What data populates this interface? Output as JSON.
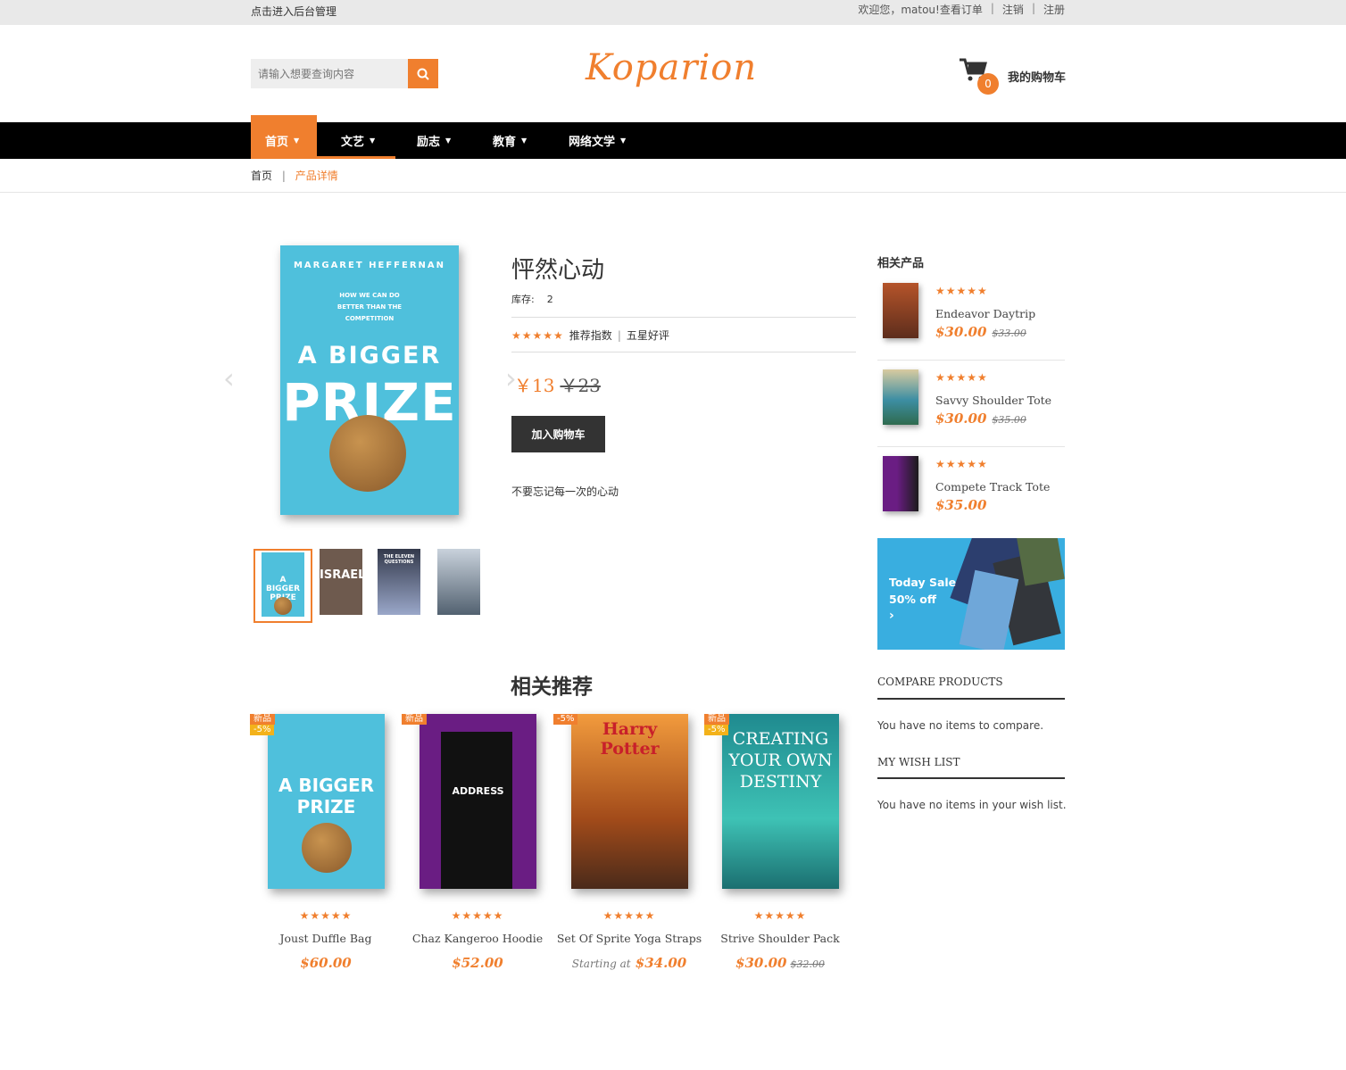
{
  "topbar": {
    "admin": "点击进入后台管理",
    "welcome": "欢迎您，matou!",
    "orders": "查看订单",
    "logout": "注销",
    "register": "注册"
  },
  "search": {
    "placeholder": "请输入想要查询内容"
  },
  "logo": "Koparion",
  "cart": {
    "count": "0",
    "label": "我的购物车"
  },
  "nav": [
    "首页",
    "文艺",
    "励志",
    "教育",
    "网络文学"
  ],
  "breadcrumb": {
    "home": "首页",
    "current": "产品详情"
  },
  "product": {
    "title": "怦然心动",
    "stock_label": "库存:",
    "stock": "2",
    "rating_text1": "推荐指数",
    "rating_text2": "五星好评",
    "price": "￥13",
    "old_price": "￥23",
    "add_to_cart": "加入购物车",
    "description": "不要忘记每一次的心动"
  },
  "main_cover": {
    "author": "MARGARET HEFFERNAN",
    "subtitle": "HOW WE CAN DO BETTER THAN THE COMPETITION",
    "title1": "A BIGGER",
    "title2": "PRIZE"
  },
  "thumb_covers": [
    "A BIGGER PRIZE",
    "ISRAEL",
    "THE ELEVEN QUESTIONS",
    ""
  ],
  "related": {
    "title": "相关产品",
    "items": [
      {
        "name": "Endeavor Daytrip",
        "price": "$30.00",
        "old": "$33.00"
      },
      {
        "name": "Savvy Shoulder Tote",
        "price": "$30.00",
        "old": "$35.00"
      },
      {
        "name": "Compete Track Tote",
        "price": "$35.00",
        "old": ""
      }
    ]
  },
  "banner": {
    "line1": "Today Sale",
    "line2": "50% off",
    "arrow": "›"
  },
  "compare": {
    "title": "COMPARE PRODUCTS",
    "text": "You have no items to compare."
  },
  "wishlist": {
    "title": "MY WISH LIST",
    "text": "You have no items in your wish list."
  },
  "recommend": {
    "title": "相关推荐",
    "items": [
      {
        "name": "Joust Duffle Bag",
        "price": "$60.00",
        "old": "",
        "prefix": "",
        "tag": "新品",
        "tag2": "-5%",
        "cover": "A BIGGER PRIZE"
      },
      {
        "name": "Chaz Kangeroo Hoodie",
        "price": "$52.00",
        "old": "",
        "prefix": "",
        "tag": "新品",
        "tag2": "",
        "cover": "ADDRESS"
      },
      {
        "name": "Set Of Sprite Yoga Straps",
        "price": "$34.00",
        "old": "",
        "prefix": "Starting at",
        "tag": "-5%",
        "tag2": "",
        "cover": "Harry Potter"
      },
      {
        "name": "Strive Shoulder Pack",
        "price": "$30.00",
        "old": "$32.00",
        "prefix": "",
        "tag": "新品",
        "tag2": "-5%",
        "cover": "CREATING YOUR OWN DESTINY"
      }
    ]
  },
  "stars": "★★★★★",
  "colors": {
    "accent": "#f07f2e",
    "nav": "#000000",
    "banner": "#39aee0"
  }
}
